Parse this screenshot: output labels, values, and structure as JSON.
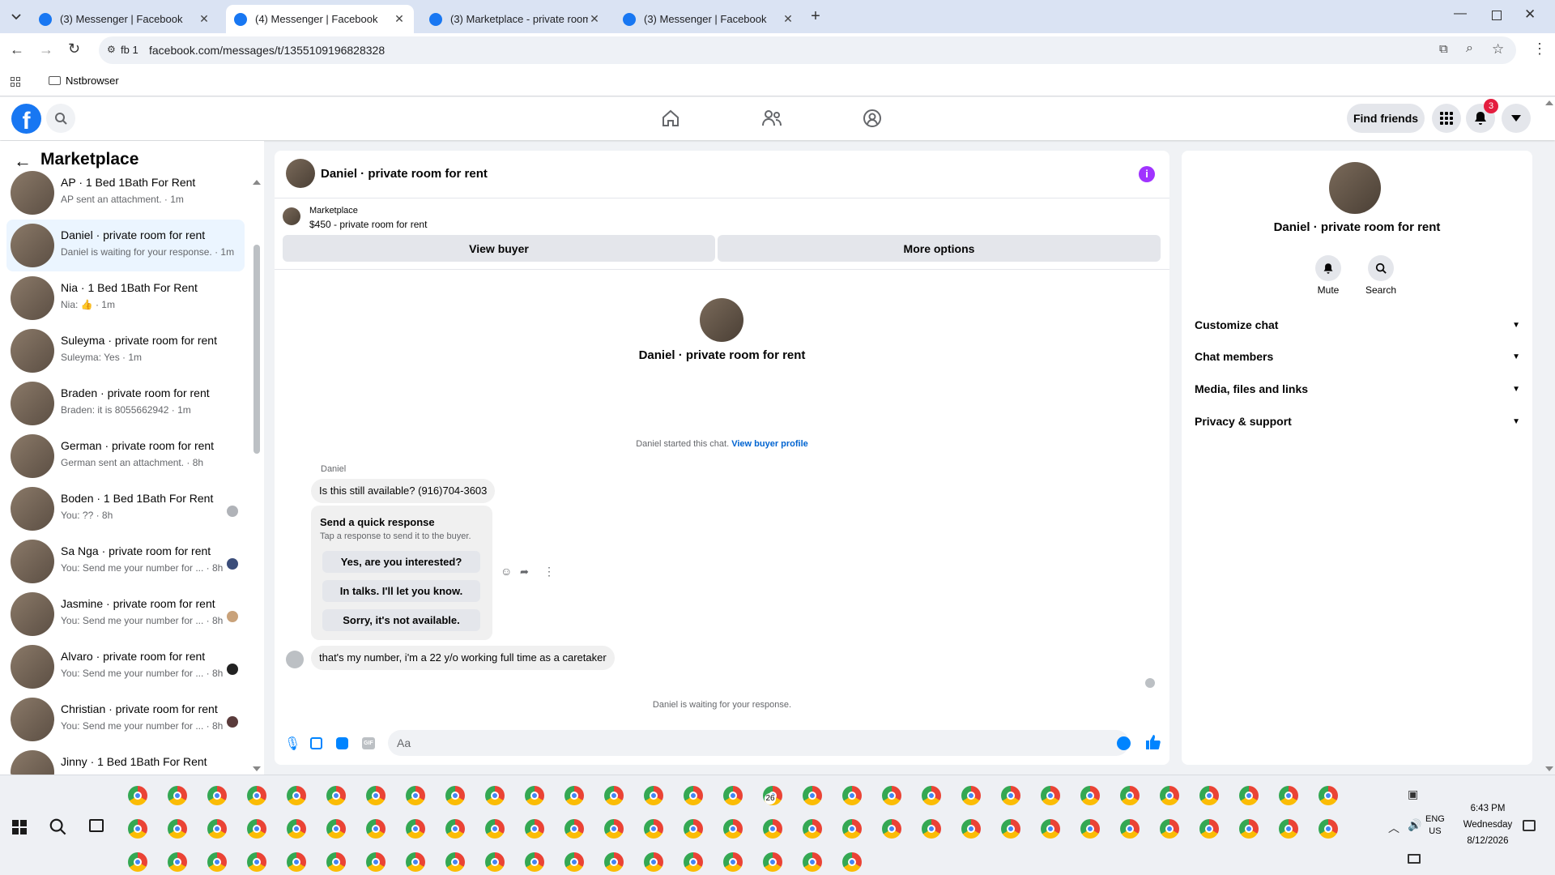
{
  "browser": {
    "tabs": [
      {
        "title": "(3) Messenger | Facebook",
        "active": false
      },
      {
        "title": "(4) Messenger | Facebook",
        "active": true
      },
      {
        "title": "(3) Marketplace - private room",
        "active": false
      },
      {
        "title": "(3) Messenger | Facebook",
        "active": false
      }
    ],
    "profile_chip": "fb 1",
    "url": "facebook.com/messages/t/1355109196828328",
    "bookmark": "Nstbrowser"
  },
  "fb": {
    "find_friends": "Find friends",
    "notifications_badge": "3",
    "brand_color": "#1877f2"
  },
  "sidebar": {
    "title": "Marketplace",
    "conversations": [
      {
        "name": "AP · 1 Bed 1Bath For Rent",
        "preview": "AP sent an attachment. · 1m",
        "selected": false
      },
      {
        "name": "Daniel · private room for rent",
        "preview": "Daniel is waiting for your response. · 1m",
        "selected": true
      },
      {
        "name": "Nia · 1 Bed 1Bath For Rent",
        "preview": "Nia: 👍 · 1m",
        "selected": false
      },
      {
        "name": "Suleyma · private room for rent",
        "preview": "Suleyma: Yes · 1m",
        "selected": false
      },
      {
        "name": "Braden · private room for rent",
        "preview": "Braden: it is 8055662942 · 1m",
        "selected": false
      },
      {
        "name": "German · private room for rent",
        "preview": "German sent an attachment. · 8h",
        "selected": false
      },
      {
        "name": "Boden · 1 Bed 1Bath For Rent",
        "preview": "You: ?? · 8h",
        "selected": false
      },
      {
        "name": "Sa Nga · private room for rent",
        "preview": "You: Send me your number for ... · 8h",
        "selected": false
      },
      {
        "name": "Jasmine · private room for rent",
        "preview": "You: Send me your number for ... · 8h",
        "selected": false
      },
      {
        "name": "Alvaro · private room for rent",
        "preview": "You: Send me your number for ... · 8h",
        "selected": false
      },
      {
        "name": "Christian · private room for rent",
        "preview": "You: Send me your number for ... · 8h",
        "selected": false
      },
      {
        "name": "Jinny · 1 Bed 1Bath For Rent",
        "preview": "",
        "selected": false
      }
    ]
  },
  "chat": {
    "title": "Daniel · private room for rent",
    "listing_source": "Marketplace",
    "listing_title": "$450 - private room for rent",
    "view_buyer": "View buyer",
    "more_options": "More options",
    "profile_name": "Daniel · private room for rent",
    "started_text": "Daniel started this chat.",
    "view_buyer_profile": "View buyer profile",
    "sender_name": "Daniel",
    "message1": "Is this still available? (916)704-3603",
    "quick_response_title": "Send a quick response",
    "quick_response_sub": "Tap a response to send it to the buyer.",
    "quick_responses": [
      "Yes, are you interested?",
      "In talks. I'll let you know.",
      "Sorry, it's not available."
    ],
    "message2": "that's my number, i'm a 22 y/o working full time as a caretaker",
    "waiting_text": "Daniel is waiting for your response.",
    "composer_placeholder": "Aa"
  },
  "details": {
    "name": "Daniel · private room for rent",
    "mute": "Mute",
    "search": "Search",
    "sections": [
      "Customize chat",
      "Chat members",
      "Media, files and links",
      "Privacy & support"
    ]
  },
  "taskbar": {
    "time": "6:43 PM",
    "day": "Wednesday",
    "date": "8/12/2026",
    "lang1": "ENG",
    "lang2": "US",
    "whatsapp_badge": "26"
  }
}
